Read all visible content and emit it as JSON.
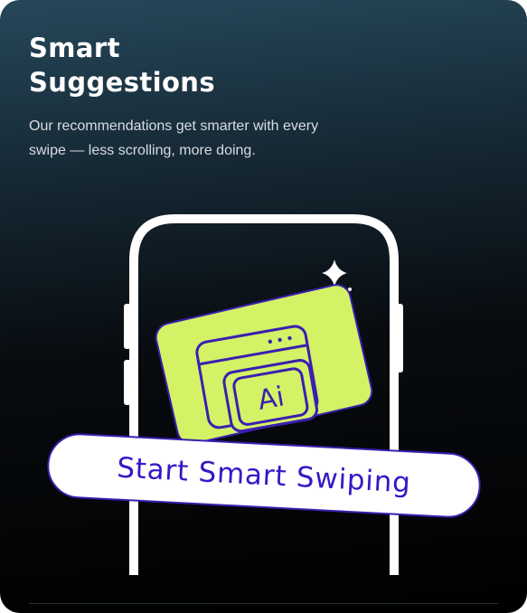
{
  "card": {
    "title": "Smart Suggestions",
    "description": "Our recommendations get smarter with every swipe — less scrolling, more doing."
  },
  "illustration": {
    "badge_text": "Ai",
    "accent_color": "#d4f266",
    "outline_color": "#3a1fb0"
  },
  "cta": {
    "label": "Start Smart Swiping"
  }
}
